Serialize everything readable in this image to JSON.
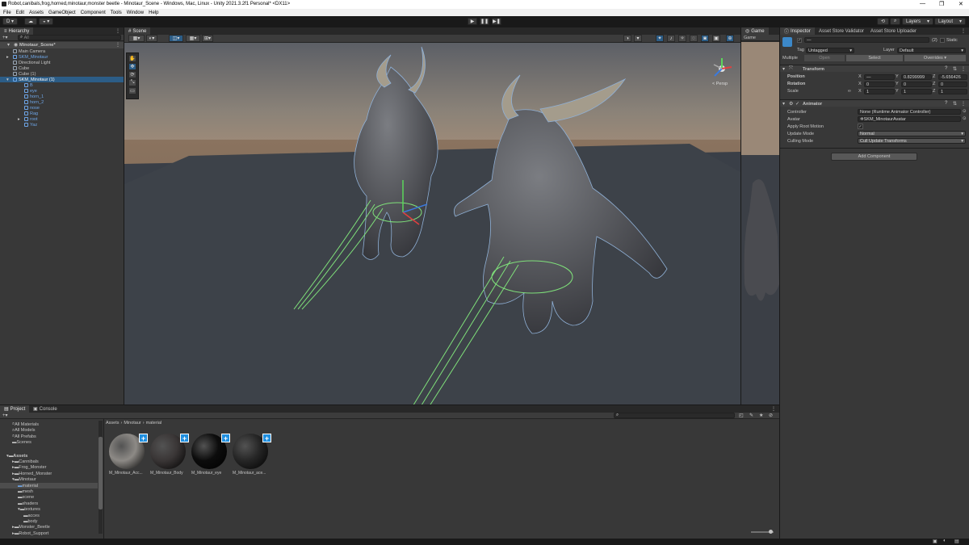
{
  "window": {
    "title": "Robot,canibals,frog,horned,minotaur,monster beetle - Minotaur_Scene - Windows, Mac, Linux - Unity 2021.3.2f1 Personal* <DX11>"
  },
  "menu": [
    "File",
    "Edit",
    "Assets",
    "GameObject",
    "Component",
    "Tools",
    "Window",
    "Help"
  ],
  "toolbar": {
    "account": "D",
    "layers": "Layers",
    "layout": "Layout"
  },
  "hierarchy": {
    "tab": "Hierarchy",
    "search_placeholder": "All",
    "scene": "Minotaur_Scene*",
    "items": [
      {
        "label": "Main Camera",
        "blue": false
      },
      {
        "label": "SKM_Minotaur",
        "blue": true
      },
      {
        "label": "Directional Light",
        "blue": false
      },
      {
        "label": "Cube",
        "blue": false
      },
      {
        "label": "Cube (1)",
        "blue": false
      },
      {
        "label": "SKM_Minotaur (1)",
        "blue": true
      },
      {
        "label": "B",
        "blue": true
      },
      {
        "label": "eye",
        "blue": true
      },
      {
        "label": "horn_1",
        "blue": true
      },
      {
        "label": "horn_2",
        "blue": true
      },
      {
        "label": "nose",
        "blue": true
      },
      {
        "label": "Rag",
        "blue": true
      },
      {
        "label": "root",
        "blue": true
      },
      {
        "label": "Yaz",
        "blue": true
      }
    ]
  },
  "scene": {
    "tab": "Scene",
    "gizmo_label": "< Persp"
  },
  "game": {
    "tab": "Game",
    "display": "Game"
  },
  "inspector": {
    "tabs": [
      "Inspector",
      "Asset Store Validator",
      "Asset Store Uploader"
    ],
    "name_field": "—",
    "count": "(2)",
    "static_label": "Static",
    "tag_label": "Tag",
    "tag_value": "Untagged",
    "layer_label": "Layer",
    "layer_value": "Default",
    "multiple_label": "Multiple",
    "open_label": "Open",
    "select_label": "Select",
    "overrides_label": "Overrides",
    "transform": {
      "title": "Transform",
      "position_label": "Position",
      "rotation_label": "Rotation",
      "scale_label": "Scale",
      "pos_x": "—",
      "pos_y": "0.8299999",
      "pos_z": "-5.656426",
      "rot_x": "0",
      "rot_y": "0",
      "rot_z": "0",
      "scale_x": "1",
      "scale_y": "1",
      "scale_z": "1"
    },
    "animator": {
      "title": "Animator",
      "controller_label": "Controller",
      "controller_value": "None (Runtime Animator Controller)",
      "avatar_label": "Avatar",
      "avatar_value": "SKM_MinotaurAvatar",
      "root_motion_label": "Apply Root Motion",
      "update_mode_label": "Update Mode",
      "update_mode_value": "Normal",
      "culling_label": "Culling Mode",
      "culling_value": "Cull Update Transforms"
    },
    "add_component": "Add Component"
  },
  "project": {
    "tabs": [
      "Project",
      "Console"
    ],
    "favorites": [
      "All Materials",
      "All Models",
      "All Prefabs",
      "Scenes"
    ],
    "tree": [
      {
        "label": "Assets",
        "indent": 0,
        "bold": true
      },
      {
        "label": "Cannibals",
        "indent": 1
      },
      {
        "label": "Frog_Monster",
        "indent": 1
      },
      {
        "label": "Horned_Monster",
        "indent": 1
      },
      {
        "label": "Minotaur",
        "indent": 1
      },
      {
        "label": "material",
        "indent": 2,
        "selected": true
      },
      {
        "label": "mesh",
        "indent": 2
      },
      {
        "label": "scene",
        "indent": 2
      },
      {
        "label": "shaders",
        "indent": 2
      },
      {
        "label": "textures",
        "indent": 2
      },
      {
        "label": "acces",
        "indent": 3
      },
      {
        "label": "body",
        "indent": 3
      },
      {
        "label": "Monster_Beetle",
        "indent": 1
      },
      {
        "label": "Robot_Support",
        "indent": 1
      }
    ],
    "breadcrumb": [
      "Assets",
      "Minotaur",
      "material"
    ],
    "assets": [
      {
        "label": "M_Minotaur_Acc...",
        "color": "#8d8a86"
      },
      {
        "label": "M_Minotaur_Body",
        "color": "#3a3636"
      },
      {
        "label": "M_Minotaur_eye",
        "color": "#0c0c0c"
      },
      {
        "label": "M_Minotaur_ace...",
        "color": "#262626"
      }
    ]
  },
  "colors": {
    "accent": "#2c5d87",
    "selection_blue": "#6ea6e8",
    "panel": "#383838"
  }
}
